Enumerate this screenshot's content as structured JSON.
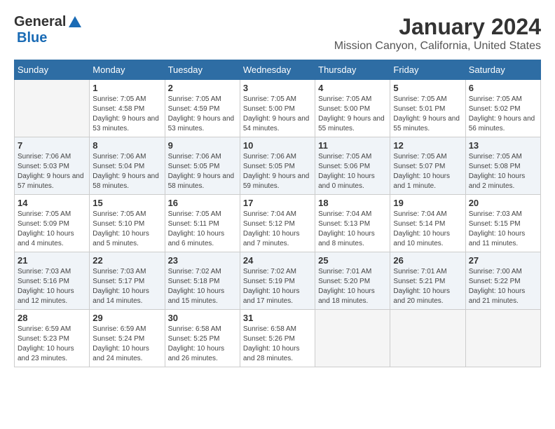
{
  "logo": {
    "general": "General",
    "blue": "Blue"
  },
  "title": "January 2024",
  "location": "Mission Canyon, California, United States",
  "days_of_week": [
    "Sunday",
    "Monday",
    "Tuesday",
    "Wednesday",
    "Thursday",
    "Friday",
    "Saturday"
  ],
  "weeks": [
    [
      {
        "day": "",
        "empty": true
      },
      {
        "day": "1",
        "sunrise": "7:05 AM",
        "sunset": "4:58 PM",
        "daylight": "9 hours and 53 minutes."
      },
      {
        "day": "2",
        "sunrise": "7:05 AM",
        "sunset": "4:59 PM",
        "daylight": "9 hours and 53 minutes."
      },
      {
        "day": "3",
        "sunrise": "7:05 AM",
        "sunset": "5:00 PM",
        "daylight": "9 hours and 54 minutes."
      },
      {
        "day": "4",
        "sunrise": "7:05 AM",
        "sunset": "5:00 PM",
        "daylight": "9 hours and 55 minutes."
      },
      {
        "day": "5",
        "sunrise": "7:05 AM",
        "sunset": "5:01 PM",
        "daylight": "9 hours and 55 minutes."
      },
      {
        "day": "6",
        "sunrise": "7:05 AM",
        "sunset": "5:02 PM",
        "daylight": "9 hours and 56 minutes."
      }
    ],
    [
      {
        "day": "7",
        "sunrise": "7:06 AM",
        "sunset": "5:03 PM",
        "daylight": "9 hours and 57 minutes."
      },
      {
        "day": "8",
        "sunrise": "7:06 AM",
        "sunset": "5:04 PM",
        "daylight": "9 hours and 58 minutes."
      },
      {
        "day": "9",
        "sunrise": "7:06 AM",
        "sunset": "5:05 PM",
        "daylight": "9 hours and 58 minutes."
      },
      {
        "day": "10",
        "sunrise": "7:06 AM",
        "sunset": "5:05 PM",
        "daylight": "9 hours and 59 minutes."
      },
      {
        "day": "11",
        "sunrise": "7:05 AM",
        "sunset": "5:06 PM",
        "daylight": "10 hours and 0 minutes."
      },
      {
        "day": "12",
        "sunrise": "7:05 AM",
        "sunset": "5:07 PM",
        "daylight": "10 hours and 1 minute."
      },
      {
        "day": "13",
        "sunrise": "7:05 AM",
        "sunset": "5:08 PM",
        "daylight": "10 hours and 2 minutes."
      }
    ],
    [
      {
        "day": "14",
        "sunrise": "7:05 AM",
        "sunset": "5:09 PM",
        "daylight": "10 hours and 4 minutes."
      },
      {
        "day": "15",
        "sunrise": "7:05 AM",
        "sunset": "5:10 PM",
        "daylight": "10 hours and 5 minutes."
      },
      {
        "day": "16",
        "sunrise": "7:05 AM",
        "sunset": "5:11 PM",
        "daylight": "10 hours and 6 minutes."
      },
      {
        "day": "17",
        "sunrise": "7:04 AM",
        "sunset": "5:12 PM",
        "daylight": "10 hours and 7 minutes."
      },
      {
        "day": "18",
        "sunrise": "7:04 AM",
        "sunset": "5:13 PM",
        "daylight": "10 hours and 8 minutes."
      },
      {
        "day": "19",
        "sunrise": "7:04 AM",
        "sunset": "5:14 PM",
        "daylight": "10 hours and 10 minutes."
      },
      {
        "day": "20",
        "sunrise": "7:03 AM",
        "sunset": "5:15 PM",
        "daylight": "10 hours and 11 minutes."
      }
    ],
    [
      {
        "day": "21",
        "sunrise": "7:03 AM",
        "sunset": "5:16 PM",
        "daylight": "10 hours and 12 minutes."
      },
      {
        "day": "22",
        "sunrise": "7:03 AM",
        "sunset": "5:17 PM",
        "daylight": "10 hours and 14 minutes."
      },
      {
        "day": "23",
        "sunrise": "7:02 AM",
        "sunset": "5:18 PM",
        "daylight": "10 hours and 15 minutes."
      },
      {
        "day": "24",
        "sunrise": "7:02 AM",
        "sunset": "5:19 PM",
        "daylight": "10 hours and 17 minutes."
      },
      {
        "day": "25",
        "sunrise": "7:01 AM",
        "sunset": "5:20 PM",
        "daylight": "10 hours and 18 minutes."
      },
      {
        "day": "26",
        "sunrise": "7:01 AM",
        "sunset": "5:21 PM",
        "daylight": "10 hours and 20 minutes."
      },
      {
        "day": "27",
        "sunrise": "7:00 AM",
        "sunset": "5:22 PM",
        "daylight": "10 hours and 21 minutes."
      }
    ],
    [
      {
        "day": "28",
        "sunrise": "6:59 AM",
        "sunset": "5:23 PM",
        "daylight": "10 hours and 23 minutes."
      },
      {
        "day": "29",
        "sunrise": "6:59 AM",
        "sunset": "5:24 PM",
        "daylight": "10 hours and 24 minutes."
      },
      {
        "day": "30",
        "sunrise": "6:58 AM",
        "sunset": "5:25 PM",
        "daylight": "10 hours and 26 minutes."
      },
      {
        "day": "31",
        "sunrise": "6:58 AM",
        "sunset": "5:26 PM",
        "daylight": "10 hours and 28 minutes."
      },
      {
        "day": "",
        "empty": true
      },
      {
        "day": "",
        "empty": true
      },
      {
        "day": "",
        "empty": true
      }
    ]
  ],
  "labels": {
    "sunrise": "Sunrise:",
    "sunset": "Sunset:",
    "daylight": "Daylight:"
  }
}
